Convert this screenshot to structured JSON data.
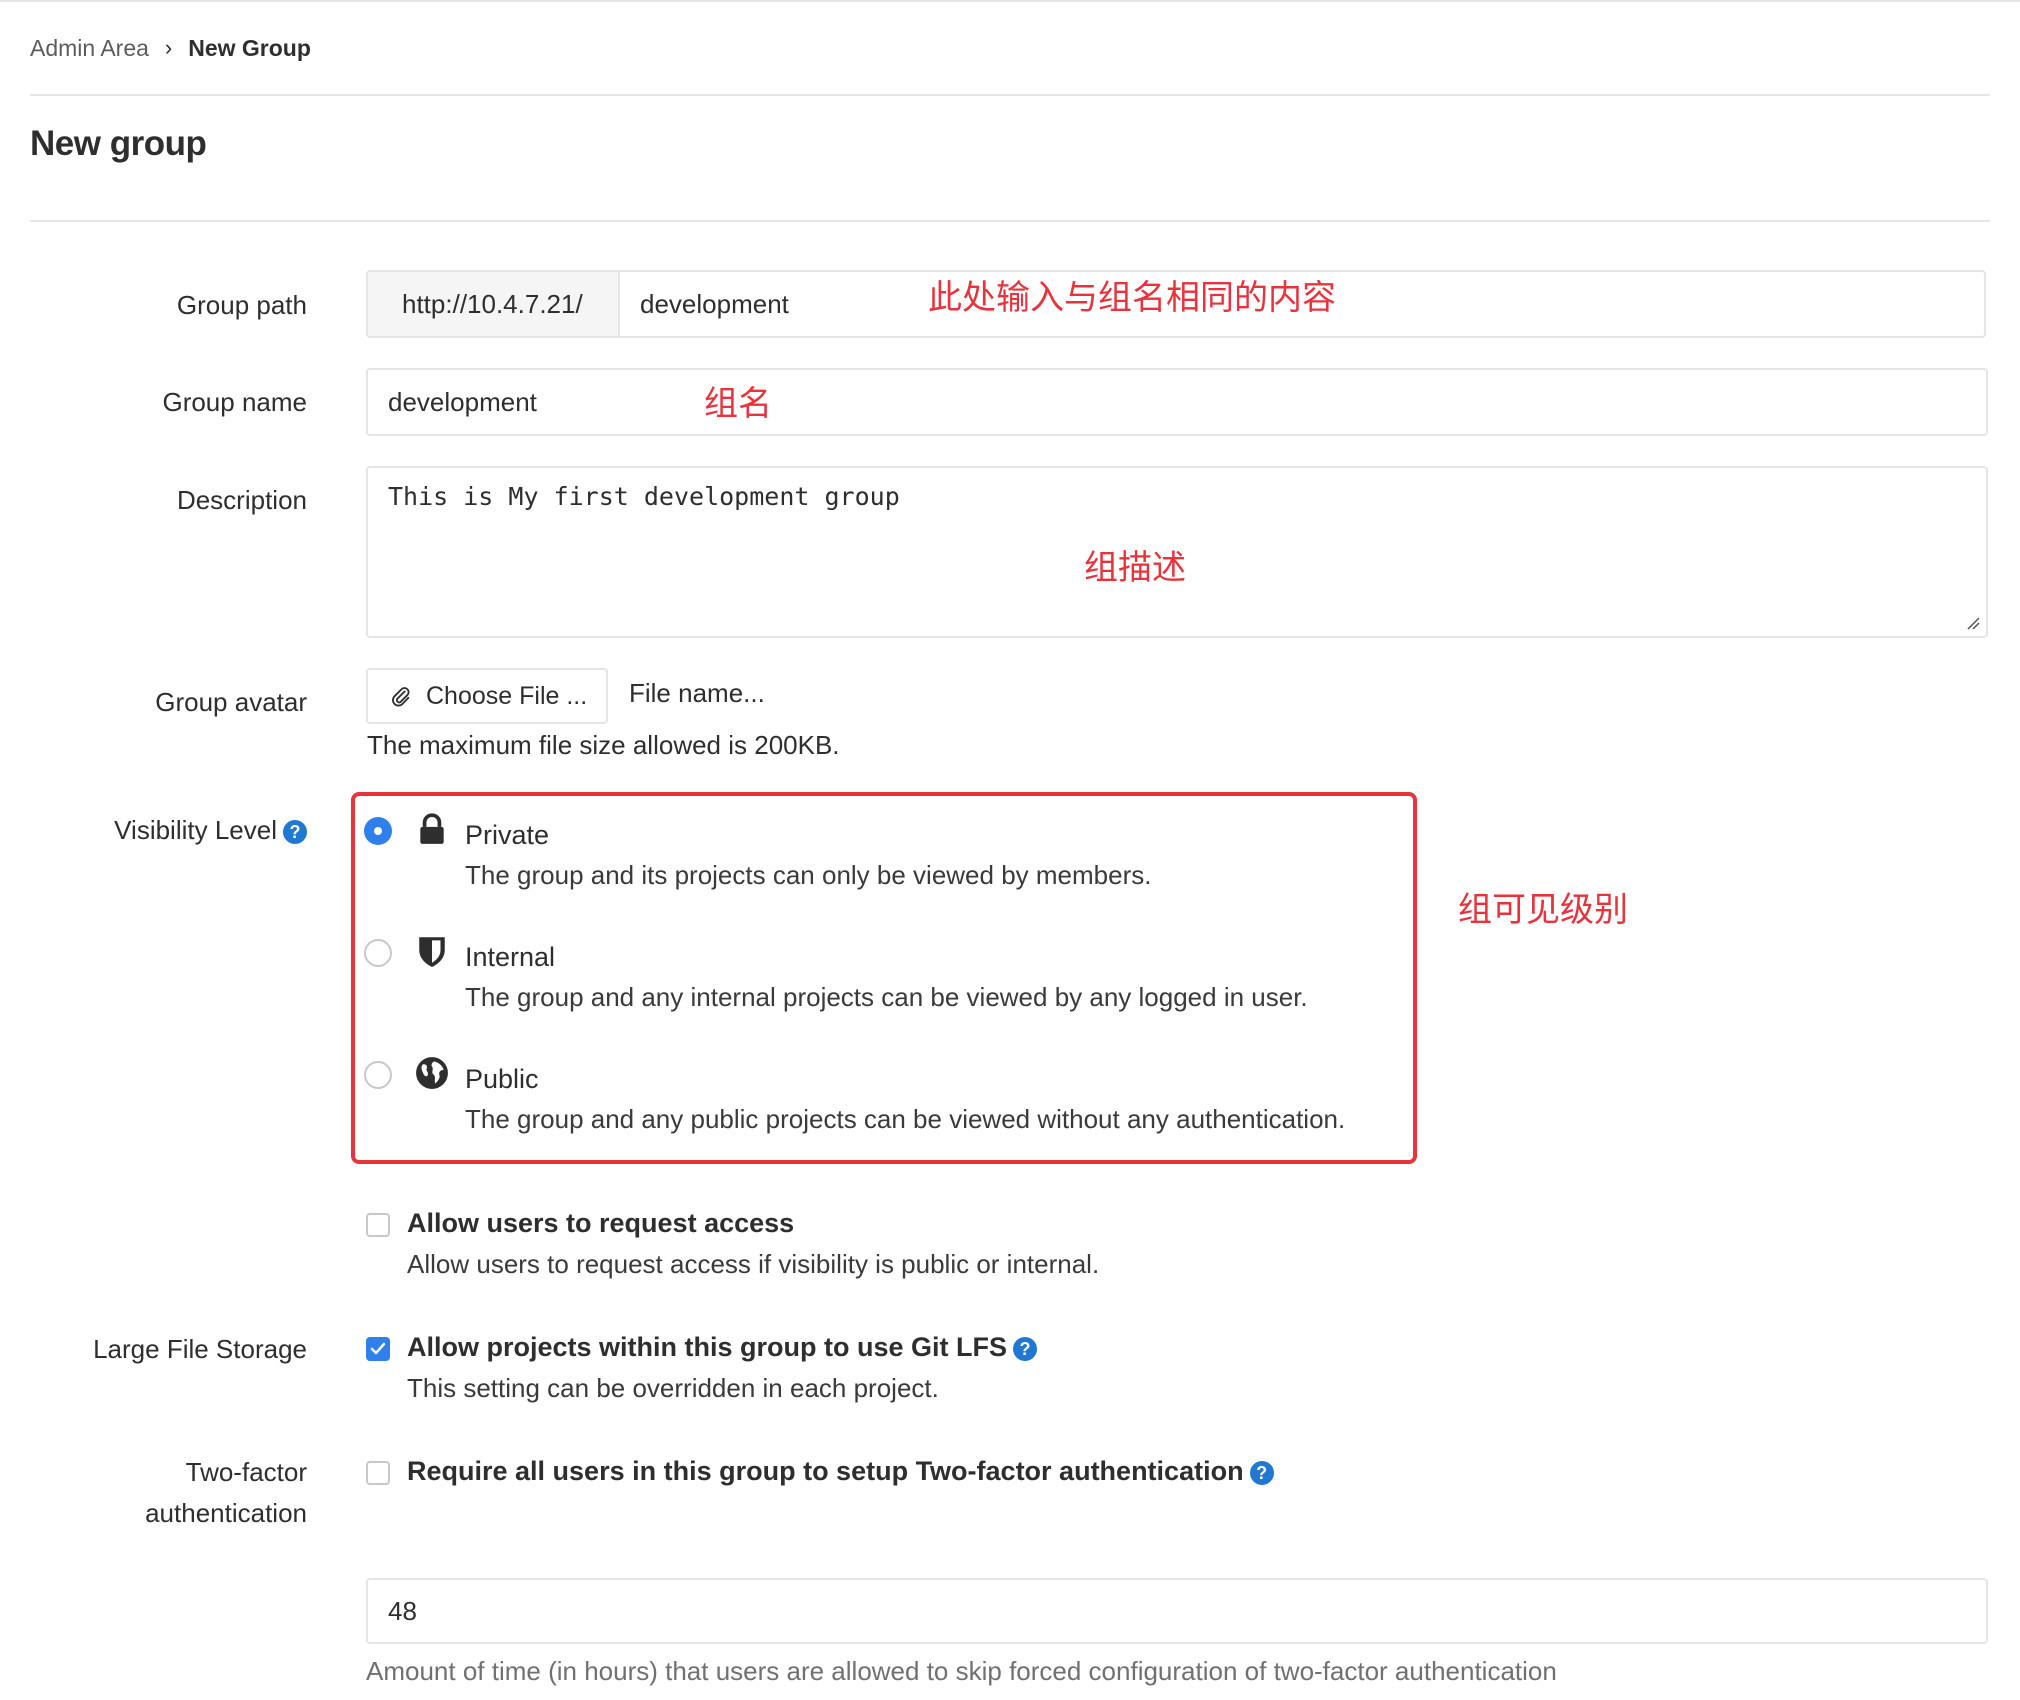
{
  "breadcrumb": {
    "parent": "Admin Area",
    "separator": "›",
    "current": "New Group"
  },
  "page_title": "New group",
  "fields": {
    "group_path": {
      "label": "Group path",
      "prefix": "http://10.4.7.21/",
      "value": "development"
    },
    "group_name": {
      "label": "Group name",
      "value": "development"
    },
    "description": {
      "label": "Description",
      "value": "This is My first development group"
    },
    "group_avatar": {
      "label": "Group avatar",
      "button": "Choose File ...",
      "file_name": "File name...",
      "help": "The maximum file size allowed is 200KB."
    },
    "visibility": {
      "label": "Visibility Level",
      "options": [
        {
          "title": "Private",
          "description": "The group and its projects can only be viewed by members.",
          "icon": "lock-icon",
          "selected": true
        },
        {
          "title": "Internal",
          "description": "The group and any internal projects can be viewed by any logged in user.",
          "icon": "shield-icon",
          "selected": false
        },
        {
          "title": "Public",
          "description": "The group and any public projects can be viewed without any authentication.",
          "icon": "earth-icon",
          "selected": false
        }
      ]
    },
    "request_access": {
      "title": "Allow users to request access",
      "description": "Allow users to request access if visibility is public or internal.",
      "checked": false
    },
    "lfs": {
      "label": "Large File Storage",
      "title": "Allow projects within this group to use Git LFS",
      "description": "This setting can be overridden in each project.",
      "checked": true
    },
    "two_factor": {
      "label_line1": "Two-factor",
      "label_line2": "authentication",
      "title": "Require all users in this group to setup Two-factor authentication",
      "checked": false,
      "grace_period": "48",
      "grace_help": "Amount of time (in hours) that users are allowed to skip forced configuration of two-factor authentication"
    }
  },
  "annotations": {
    "group_path": "此处输入与组名相同的内容",
    "group_name": "组名",
    "description": "组描述",
    "visibility": "组可见级别"
  },
  "colors": {
    "accent": "#2f80ed",
    "help": "#1f78d1",
    "annotation": "#e8323c",
    "border": "#e5e5e5"
  }
}
